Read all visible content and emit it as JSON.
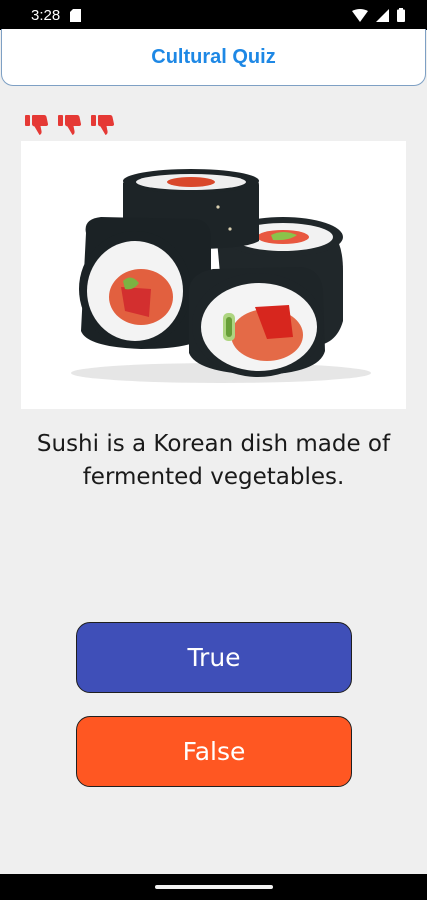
{
  "status_bar": {
    "time": "3:28",
    "icons": [
      "sd-card-icon",
      "wifi-icon",
      "signal-icon",
      "battery-icon"
    ]
  },
  "header": {
    "title": "Cultural Quiz"
  },
  "lives": {
    "icon": "thumbs-down-icon",
    "count": 3,
    "color": "#e53935"
  },
  "question": {
    "image": "sushi-rolls-image",
    "text": "Sushi is a Korean dish made of fermented vegetables."
  },
  "answers": {
    "true_label": "True",
    "false_label": "False",
    "true_color": "#3f4fb8",
    "false_color": "#ff5722"
  },
  "colors": {
    "background": "#efefef",
    "title": "#1e88e5"
  }
}
